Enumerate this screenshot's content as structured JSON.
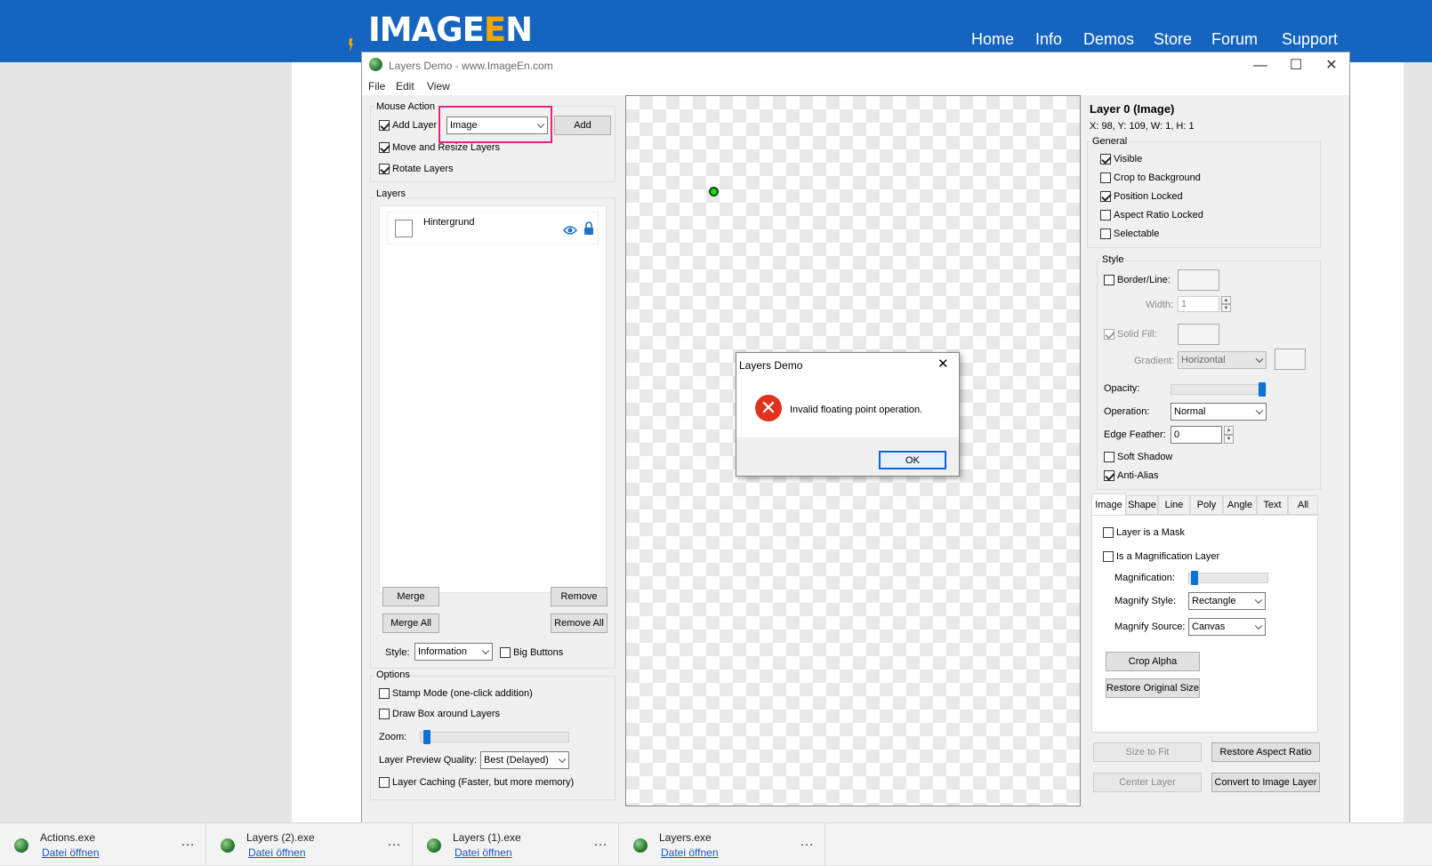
{
  "site": {
    "logo": {
      "part1": "IMAGE",
      "part2": "E",
      "part3": "N"
    },
    "nav": [
      "Home",
      "Info",
      "Demos",
      "Store",
      "Forum",
      "Support"
    ]
  },
  "window": {
    "title": "Layers Demo  - www.ImageEn.com",
    "controls": {
      "minimize": "—",
      "maximize": "☐",
      "close": "✕"
    },
    "menu": [
      "File",
      "Edit",
      "View"
    ]
  },
  "left": {
    "mouse_action": {
      "group_label": "Mouse Action",
      "add_layer": {
        "label": "Add Layer",
        "checked": true
      },
      "type_select": "Image",
      "add_button": "Add",
      "move_resize": {
        "label": "Move and Resize Layers",
        "checked": true
      },
      "rotate": {
        "label": "Rotate Layers",
        "checked": true
      }
    },
    "layers": {
      "group_label": "Layers",
      "items": [
        {
          "name": "Hintergrund"
        }
      ],
      "merge": "Merge",
      "remove": "Remove",
      "merge_all": "Merge All",
      "remove_all": "Remove All",
      "style_label": "Style:",
      "style_value": "Information",
      "big_buttons": "Big Buttons"
    },
    "options": {
      "group_label": "Options",
      "stamp_mode": "Stamp Mode (one-click addition)",
      "draw_box": "Draw Box around Layers",
      "zoom_label": "Zoom:",
      "quality_label": "Layer Preview Quality:",
      "quality_value": "Best (Delayed)",
      "caching": "Layer Caching (Faster, but more memory)"
    }
  },
  "dialog": {
    "title": "Layers Demo",
    "message": "Invalid floating point operation.",
    "ok": "OK",
    "close": "✕",
    "error_glyph": "✕"
  },
  "right": {
    "header": "Layer 0 (Image)",
    "coords": "X: 98, Y: 109, W: 1, H: 1",
    "general": {
      "label": "General",
      "visible": "Visible",
      "crop_bg": "Crop to Background",
      "pos_locked": "Position Locked",
      "aspect_locked": "Aspect Ratio Locked",
      "selectable": "Selectable"
    },
    "style": {
      "label": "Style",
      "border_line": "Border/Line:",
      "width_label": "Width:",
      "width_value": "1",
      "solid_fill": "Solid Fill:",
      "gradient_label": "Gradient:",
      "gradient_value": "Horizontal",
      "opacity_label": "Opacity:",
      "opacity_level": 1.0,
      "operation_label": "Operation:",
      "operation_value": "Normal",
      "edge_label": "Edge Feather:",
      "edge_value": "0",
      "soft_shadow": "Soft Shadow",
      "anti_alias": "Anti-Alias"
    },
    "tabs": [
      "Image",
      "Shape",
      "Line",
      "Poly",
      "Angle",
      "Text",
      "All"
    ],
    "image_tab": {
      "is_mask": "Layer is a Mask",
      "is_magnify": "Is a Magnification Layer",
      "magnification_label": "Magnification:",
      "magnify_style_label": "Magnify Style:",
      "magnify_style_value": "Rectangle",
      "magnify_source_label": "Magnify Source:",
      "magnify_source_value": "Canvas",
      "crop_alpha": "Crop Alpha",
      "restore_size": "Restore Original Size"
    },
    "bottom": {
      "size_to_fit": "Size to Fit",
      "restore_aspect": "Restore Aspect Ratio",
      "center_layer": "Center Layer",
      "convert": "Convert to Image Layer"
    }
  },
  "taskbar": [
    {
      "name": "Actions.exe",
      "link": "Datei öffnen"
    },
    {
      "name": "Layers (2).exe",
      "link": "Datei öffnen"
    },
    {
      "name": "Layers (1).exe",
      "link": "Datei öffnen"
    },
    {
      "name": "Layers.exe",
      "link": "Datei öffnen"
    }
  ],
  "taskbar_more": "…",
  "colors": {
    "brand_blue": "#1565c0",
    "logo_orange": "#f7a600",
    "highlight_pink": "#e0287a",
    "error_red": "#e0321e"
  }
}
